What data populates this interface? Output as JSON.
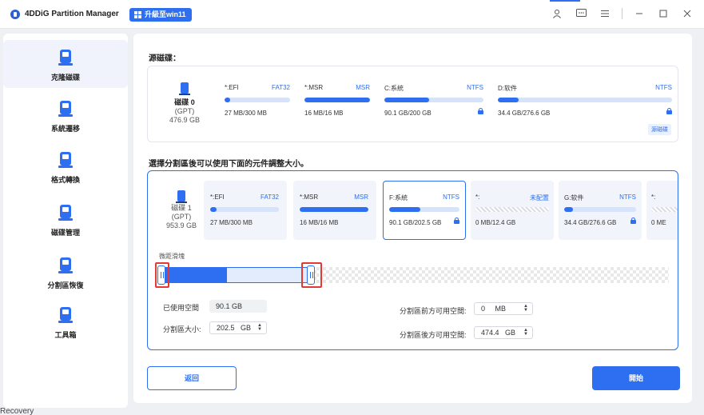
{
  "app": {
    "title": "4DDiG Partition Manager",
    "upgrade_label": "升級至win11"
  },
  "titlebar_icons": [
    "user-icon",
    "chat-icon",
    "menu-icon",
    "minimize-icon",
    "maximize-icon",
    "close-icon"
  ],
  "sidebar": {
    "items": [
      {
        "label": "克隆磁碟",
        "icon": "clone-disk-icon",
        "active": true
      },
      {
        "label": "系統遷移",
        "icon": "system-migration-icon",
        "active": false
      },
      {
        "label": "格式轉換",
        "icon": "format-convert-icon",
        "active": false
      },
      {
        "label": "磁碟管理",
        "icon": "disk-management-icon",
        "active": false
      },
      {
        "label": "分割區恢復",
        "icon": "partition-recovery-icon",
        "active": false
      },
      {
        "label": "工具箱",
        "icon": "toolbox-icon",
        "active": false
      }
    ]
  },
  "source": {
    "section_title": "源磁碟：",
    "disk_name": "磁碟 0",
    "disk_type": "(GPT)",
    "disk_size": "476.9 GB",
    "source_badge": "源磁碟",
    "partitions": [
      {
        "name": "*:EFI",
        "fs": "FAT32",
        "size": "27 MB/300 MB",
        "used_fraction": 0.09,
        "locked": false
      },
      {
        "name": "*:MSR",
        "fs": "MSR",
        "size": "16 MB/16 MB",
        "used_fraction": 1.0,
        "locked": false
      },
      {
        "name": "C:系統",
        "fs": "NTFS",
        "size": "90.1 GB/200 GB",
        "used_fraction": 0.45,
        "locked": true
      },
      {
        "name": "D:软件",
        "fs": "NTFS",
        "size": "34.4 GB/276.6 GB",
        "used_fraction": 0.12,
        "locked": true
      }
    ]
  },
  "target": {
    "section_title": "選擇分割區後可以使用下面的元件調整大小。",
    "disk_name": "磁碟 1",
    "disk_type": "(GPT)",
    "disk_size": "953.9 GB",
    "partitions": [
      {
        "name": "*:EFI",
        "fs": "FAT32",
        "size": "27 MB/300 MB",
        "used_fraction": 0.09,
        "locked": false,
        "unallocated": false
      },
      {
        "name": "*:MSR",
        "fs": "MSR",
        "size": "16 MB/16 MB",
        "used_fraction": 1.0,
        "locked": false,
        "unallocated": false
      },
      {
        "name": "F:系統",
        "fs": "NTFS",
        "size": "90.1 GB/202.5 GB",
        "used_fraction": 0.44,
        "locked": true,
        "unallocated": false,
        "selected": true
      },
      {
        "name": "*:",
        "fs": "未配置",
        "size": "0 MB/12.4 GB",
        "used_fraction": 0,
        "locked": false,
        "unallocated": true
      },
      {
        "name": "G:软件",
        "fs": "NTFS",
        "size": "34.4 GB/276.6 GB",
        "used_fraction": 0.12,
        "locked": true,
        "unallocated": false
      },
      {
        "name": "*:",
        "fs": "",
        "size": "0 ME",
        "used_fraction": 0,
        "locked": false,
        "unallocated": true
      }
    ],
    "slider_label": "微距滑塊",
    "slider": {
      "used_fraction": 0.44
    },
    "used_space_label": "已使用空間",
    "used_space_value": "90.1 GB",
    "partition_size_label": "分割區大小:",
    "partition_size_value": "202.5",
    "partition_size_unit": "GB",
    "space_before_label": "分割區前方可用空間:",
    "space_before_value": "0",
    "space_before_unit": "MB",
    "space_after_label": "分割區後方可用空間:",
    "space_after_value": "474.4",
    "space_after_unit": "GB"
  },
  "buttons": {
    "back": "返回",
    "start": "開始"
  },
  "background_text": "Recovery",
  "colors": {
    "accent": "#2d6ff0",
    "highlight": "#e53935"
  }
}
